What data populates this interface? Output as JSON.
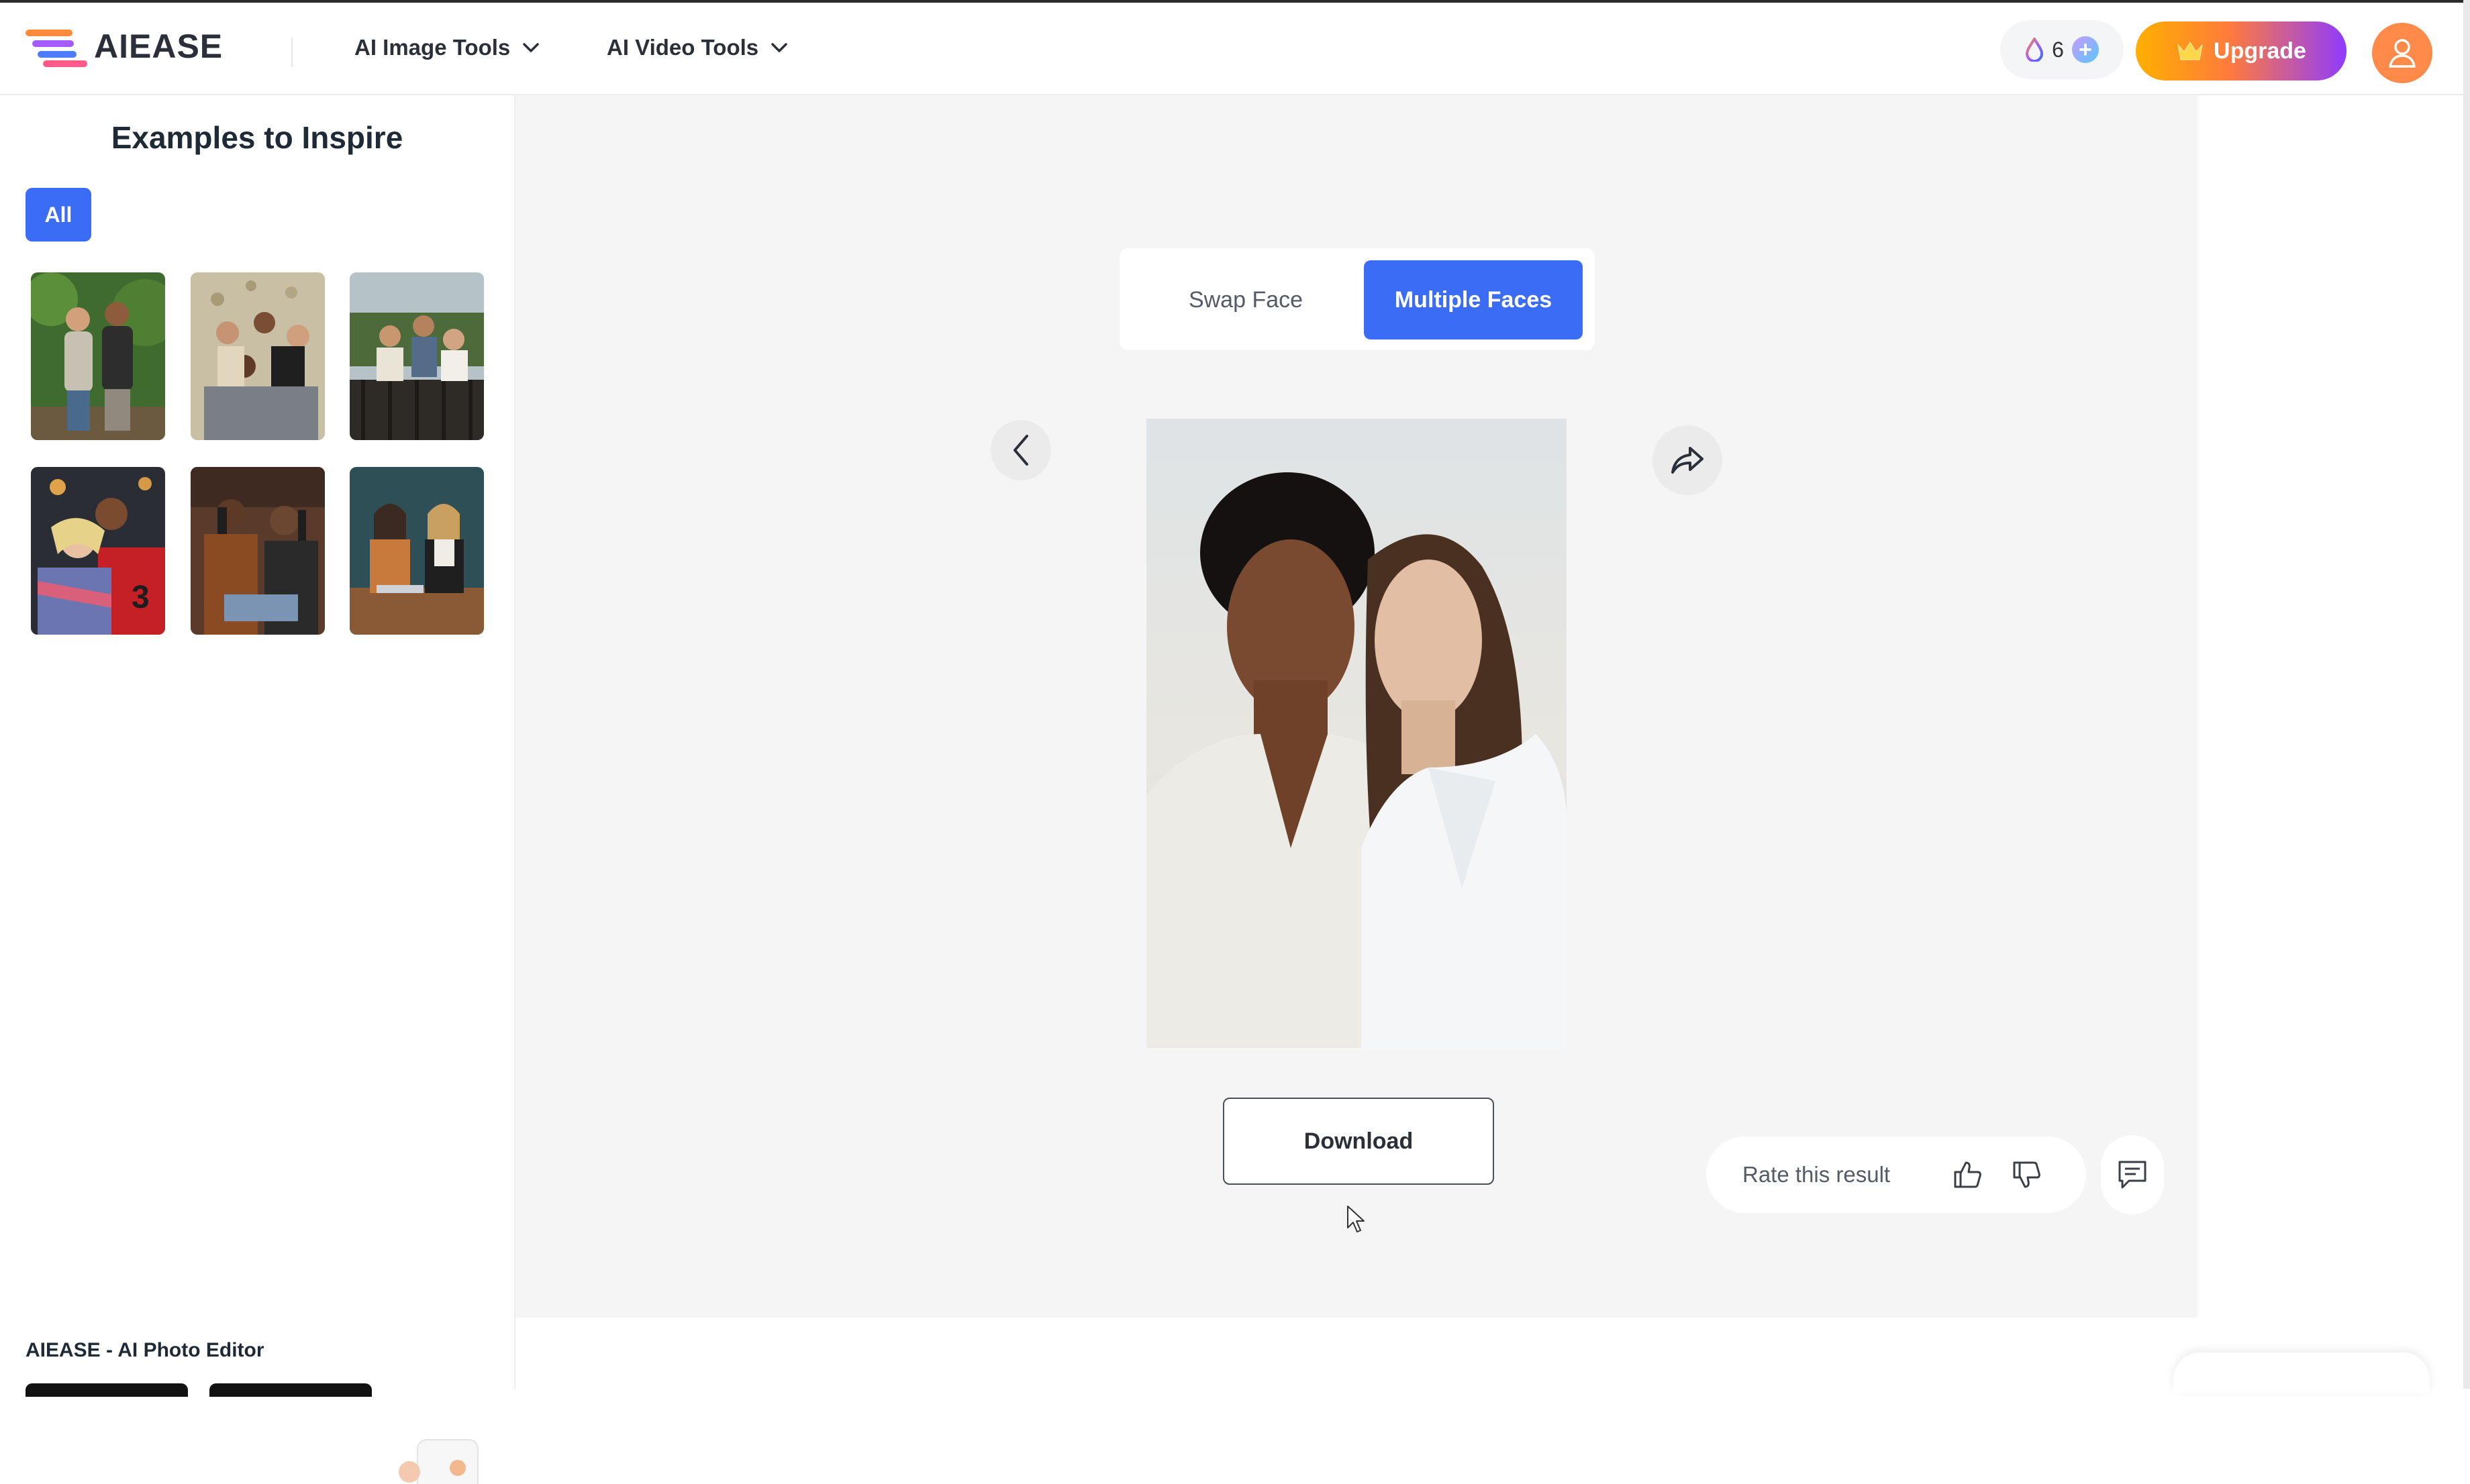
{
  "header": {
    "logo_text": "AIEASE",
    "nav": [
      {
        "label": "AI Image Tools"
      },
      {
        "label": "AI Video Tools"
      }
    ],
    "credits_count": "6",
    "upgrade_label": "Upgrade"
  },
  "sidebar": {
    "title": "Examples to Inspire",
    "filter_chip": "All",
    "footer_text": "AIEASE - AI Photo Editor"
  },
  "main": {
    "tabs": [
      {
        "label": "Swap Face",
        "active": false
      },
      {
        "label": "Multiple Faces",
        "active": true
      }
    ],
    "download_label": "Download",
    "rate_label": "Rate this result"
  },
  "colors": {
    "accent": "#3b6cf6",
    "upgrade_gradient": [
      "#ffb000",
      "#ff7a3d",
      "#8f3cff"
    ],
    "avatar": "#ff8a4a",
    "stage_bg": "#f5f5f5"
  },
  "icons": [
    "chevron-down-icon",
    "credits-drop-icon",
    "plus-icon",
    "crown-icon",
    "user-icon",
    "chevron-left-icon",
    "share-icon",
    "thumbs-up-icon",
    "thumbs-down-icon",
    "feedback-chat-icon",
    "cursor-icon"
  ]
}
